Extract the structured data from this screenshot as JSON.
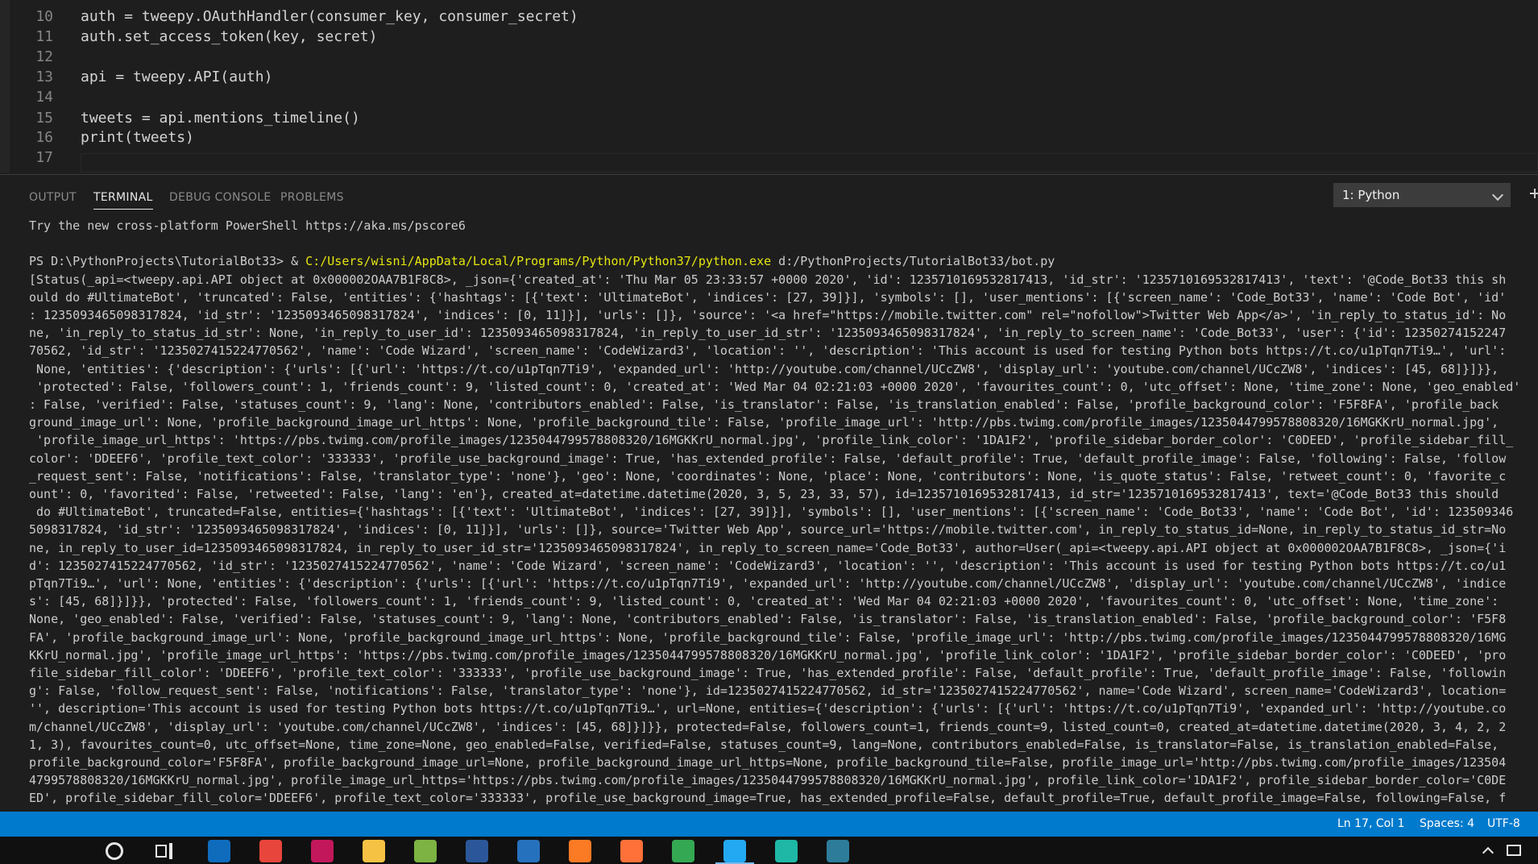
{
  "editor": {
    "lines": [
      {
        "n": "10",
        "code": "auth = tweepy.OAuthHandler(consumer_key, consumer_secret)"
      },
      {
        "n": "11",
        "code": "auth.set_access_token(key, secret)"
      },
      {
        "n": "12",
        "code": ""
      },
      {
        "n": "13",
        "code": "api = tweepy.API(auth)"
      },
      {
        "n": "14",
        "code": ""
      },
      {
        "n": "15",
        "code": "tweets = api.mentions_timeline()"
      },
      {
        "n": "16",
        "code": "print(tweets)"
      },
      {
        "n": "17",
        "code": ""
      }
    ]
  },
  "panel": {
    "tabs": [
      "OUTPUT",
      "TERMINAL",
      "DEBUG CONSOLE",
      "PROBLEMS"
    ],
    "active_tab": "TERMINAL",
    "terminal_selector": "1: Python"
  },
  "terminal": {
    "banner": "Try the new cross-platform PowerShell https://aka.ms/pscore6",
    "prompt": "PS D:\\PythonProjects\\TutorialBot33> & ",
    "python_path": "C:/Users/wisni/AppData/Local/Programs/Python/Python37/python.exe",
    "script_arg": " d:/PythonProjects/TutorialBot33/bot.py",
    "output_lines": [
      "[Status(_api=<tweepy.api.API object at 0x000002OAA7B1F8C8>, _json={'created_at': 'Thu Mar 05 23:33:57 +0000 2020', 'id': 1235710169532817413, 'id_str': '1235710169532817413', 'text': '@Code_Bot33 this sh",
      "ould do #UltimateBot', 'truncated': False, 'entities': {'hashtags': [{'text': 'UltimateBot', 'indices': [27, 39]}], 'symbols': [], 'user_mentions': [{'screen_name': 'Code_Bot33', 'name': 'Code Bot', 'id'",
      ": 1235093465098317824, 'id_str': '1235093465098317824', 'indices': [0, 11]}], 'urls': []}, 'source': '<a href=\"https://mobile.twitter.com\" rel=\"nofollow\">Twitter Web App</a>', 'in_reply_to_status_id': No",
      "ne, 'in_reply_to_status_id_str': None, 'in_reply_to_user_id': 1235093465098317824, 'in_reply_to_user_id_str': '1235093465098317824', 'in_reply_to_screen_name': 'Code_Bot33', 'user': {'id': 12350274152247",
      "70562, 'id_str': '1235027415224770562', 'name': 'Code Wizard', 'screen_name': 'CodeWizard3', 'location': '', 'description': 'This account is used for testing Python bots https://t.co/u1pTqn7Ti9…', 'url':",
      " None, 'entities': {'description': {'urls': [{'url': 'https://t.co/u1pTqn7Ti9', 'expanded_url': 'http://youtube.com/channel/UCcZW8', 'display_url': 'youtube.com/channel/UCcZW8', 'indices': [45, 68]}]}},",
      " 'protected': False, 'followers_count': 1, 'friends_count': 9, 'listed_count': 0, 'created_at': 'Wed Mar 04 02:21:03 +0000 2020', 'favourites_count': 0, 'utc_offset': None, 'time_zone': None, 'geo_enabled'",
      ": False, 'verified': False, 'statuses_count': 9, 'lang': None, 'contributors_enabled': False, 'is_translator': False, 'is_translation_enabled': False, 'profile_background_color': 'F5F8FA', 'profile_back",
      "ground_image_url': None, 'profile_background_image_url_https': None, 'profile_background_tile': False, 'profile_image_url': 'http://pbs.twimg.com/profile_images/1235044799578808320/16MGKKrU_normal.jpg',",
      " 'profile_image_url_https': 'https://pbs.twimg.com/profile_images/1235044799578808320/16MGKKrU_normal.jpg', 'profile_link_color': '1DA1F2', 'profile_sidebar_border_color': 'C0DEED', 'profile_sidebar_fill_",
      "color': 'DDEEF6', 'profile_text_color': '333333', 'profile_use_background_image': True, 'has_extended_profile': False, 'default_profile': True, 'default_profile_image': False, 'following': False, 'follow",
      "_request_sent': False, 'notifications': False, 'translator_type': 'none'}, 'geo': None, 'coordinates': None, 'place': None, 'contributors': None, 'is_quote_status': False, 'retweet_count': 0, 'favorite_c",
      "ount': 0, 'favorited': False, 'retweeted': False, 'lang': 'en'}, created_at=datetime.datetime(2020, 3, 5, 23, 33, 57), id=1235710169532817413, id_str='1235710169532817413', text='@Code_Bot33 this should",
      " do #UltimateBot', truncated=False, entities={'hashtags': [{'text': 'UltimateBot', 'indices': [27, 39]}], 'symbols': [], 'user_mentions': [{'screen_name': 'Code_Bot33', 'name': 'Code Bot', 'id': 123509346",
      "5098317824, 'id_str': '1235093465098317824', 'indices': [0, 11]}], 'urls': []}, source='Twitter Web App', source_url='https://mobile.twitter.com', in_reply_to_status_id=None, in_reply_to_status_id_str=No",
      "ne, in_reply_to_user_id=1235093465098317824, in_reply_to_user_id_str='1235093465098317824', in_reply_to_screen_name='Code_Bot33', author=User(_api=<tweepy.api.API object at 0x000002OAA7B1F8C8>, _json={'i",
      "d': 1235027415224770562, 'id_str': '1235027415224770562', 'name': 'Code Wizard', 'screen_name': 'CodeWizard3', 'location': '', 'description': 'This account is used for testing Python bots https://t.co/u1",
      "pTqn7Ti9…', 'url': None, 'entities': {'description': {'urls': [{'url': 'https://t.co/u1pTqn7Ti9', 'expanded_url': 'http://youtube.com/channel/UCcZW8', 'display_url': 'youtube.com/channel/UCcZW8', 'indice",
      "s': [45, 68]}]}}, 'protected': False, 'followers_count': 1, 'friends_count': 9, 'listed_count': 0, 'created_at': 'Wed Mar 04 02:21:03 +0000 2020', 'favourites_count': 0, 'utc_offset': None, 'time_zone':",
      "None, 'geo_enabled': False, 'verified': False, 'statuses_count': 9, 'lang': None, 'contributors_enabled': False, 'is_translator': False, 'is_translation_enabled': False, 'profile_background_color': 'F5F8",
      "FA', 'profile_background_image_url': None, 'profile_background_image_url_https': None, 'profile_background_tile': False, 'profile_image_url': 'http://pbs.twimg.com/profile_images/1235044799578808320/16MG",
      "KKrU_normal.jpg', 'profile_image_url_https': 'https://pbs.twimg.com/profile_images/1235044799578808320/16MGKKrU_normal.jpg', 'profile_link_color': '1DA1F2', 'profile_sidebar_border_color': 'C0DEED', 'pro",
      "file_sidebar_fill_color': 'DDEEF6', 'profile_text_color': '333333', 'profile_use_background_image': True, 'has_extended_profile': False, 'default_profile': True, 'default_profile_image': False, 'followin",
      "g': False, 'follow_request_sent': False, 'notifications': False, 'translator_type': 'none'}, id=1235027415224770562, id_str='1235027415224770562', name='Code Wizard', screen_name='CodeWizard3', location=",
      "'', description='This account is used for testing Python bots https://t.co/u1pTqn7Ti9…', url=None, entities={'description': {'urls': [{'url': 'https://t.co/u1pTqn7Ti9', 'expanded_url': 'http://youtube.co",
      "m/channel/UCcZW8', 'display_url': 'youtube.com/channel/UCcZW8', 'indices': [45, 68]}]}}, protected=False, followers_count=1, friends_count=9, listed_count=0, created_at=datetime.datetime(2020, 3, 4, 2, 2",
      "1, 3), favourites_count=0, utc_offset=None, time_zone=None, geo_enabled=False, verified=False, statuses_count=9, lang=None, contributors_enabled=False, is_translator=False, is_translation_enabled=False,",
      "profile_background_color='F5F8FA', profile_background_image_url=None, profile_background_image_url_https=None, profile_background_tile=False, profile_image_url='http://pbs.twimg.com/profile_images/123504",
      "4799578808320/16MGKKrU_normal.jpg', profile_image_url_https='https://pbs.twimg.com/profile_images/1235044799578808320/16MGKKrU_normal.jpg', profile_link_color='1DA1F2', profile_sidebar_border_color='C0DE",
      "ED', profile_sidebar_fill_color='DDEEF6', profile_text_color='333333', profile_use_background_image=True, has_extended_profile=False, default_profile=True, default_profile_image=False, following=False, f"
    ]
  },
  "statusbar": {
    "position": "Ln 17, Col 1",
    "indent": "Spaces: 4",
    "encoding": "UTF-8"
  },
  "taskbar": {
    "apps": [
      {
        "icon": "mail-icon",
        "color": "#0f6cbd"
      },
      {
        "icon": "chrome-icon",
        "color": "#e8453c"
      },
      {
        "icon": "intellij-icon",
        "color": "#c2185b"
      },
      {
        "icon": "file-explorer-icon",
        "color": "#f5c243"
      },
      {
        "icon": "android-icon",
        "color": "#7cb342"
      },
      {
        "icon": "word-icon",
        "color": "#2b579a"
      },
      {
        "icon": "powershell-icon",
        "color": "#2671be"
      },
      {
        "icon": "xampp-icon",
        "color": "#fb7a24"
      },
      {
        "icon": "firefox-icon",
        "color": "#ff7139"
      },
      {
        "icon": "vpn-icon",
        "color": "#34a853"
      },
      {
        "icon": "vscode-icon",
        "color": "#23a9f2"
      },
      {
        "icon": "discord-icon",
        "color": "#1fb8a6"
      },
      {
        "icon": "powerapps-icon",
        "color": "#2d7d9a"
      }
    ]
  },
  "colors": {
    "editor_bg": "#1e1e1e",
    "statusbar_bg": "#007acc",
    "terminal_path": "#e5e510"
  }
}
